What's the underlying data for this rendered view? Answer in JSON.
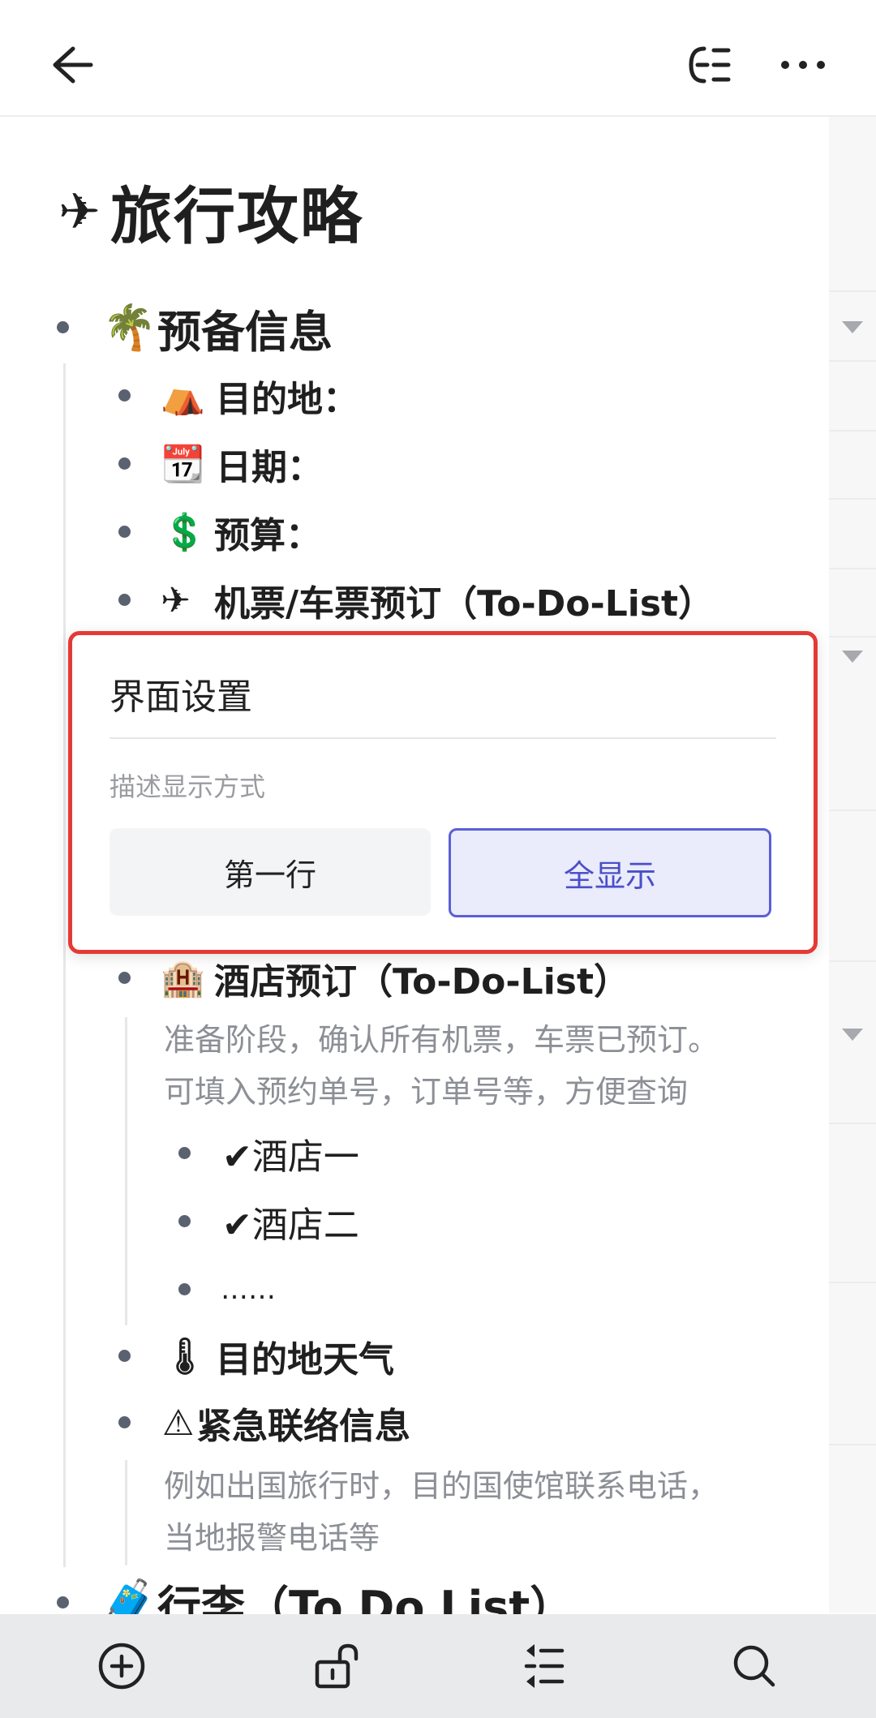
{
  "doc": {
    "title": "旅行攻略",
    "title_icon": "airplane-emoji"
  },
  "outline": {
    "prep": {
      "icon": "🌴",
      "label": "预备信息"
    },
    "destination": {
      "icon": "⛺",
      "label": "目的地："
    },
    "date": {
      "icon": "📆",
      "label": "日期："
    },
    "budget": {
      "icon": "💲",
      "label": "预算："
    },
    "tickets": {
      "label": "机票/车票预订（To-Do-List）"
    },
    "hotel": {
      "icon": "🏨",
      "label": "酒店预订（To-Do-List）"
    },
    "hotel_desc_1": "准备阶段，确认所有机票，车票已预订。",
    "hotel_desc_2": "可填入预约单号，订单号等，方便查询",
    "hotel_one": "✔酒店一",
    "hotel_two": "✔酒店二",
    "ellipsis": "……",
    "weather": {
      "icon": "🌡",
      "label": "目的地天气"
    },
    "emergency": {
      "icon": "⚠",
      "label": "紧急联络信息"
    },
    "emergency_desc_1": "例如出国旅行时，目的国使馆联系电话，",
    "emergency_desc_2": "当地报警电话等",
    "luggage": {
      "icon": "🧳",
      "label": "行李（To Do List）"
    }
  },
  "popup": {
    "title": "界面设置",
    "label": "描述显示方式",
    "option_first_line": "第一行",
    "option_show_all": "全显示",
    "selected": "全显示"
  },
  "colors": {
    "highlight": "#e53935",
    "accent": "#5a5fd6"
  }
}
